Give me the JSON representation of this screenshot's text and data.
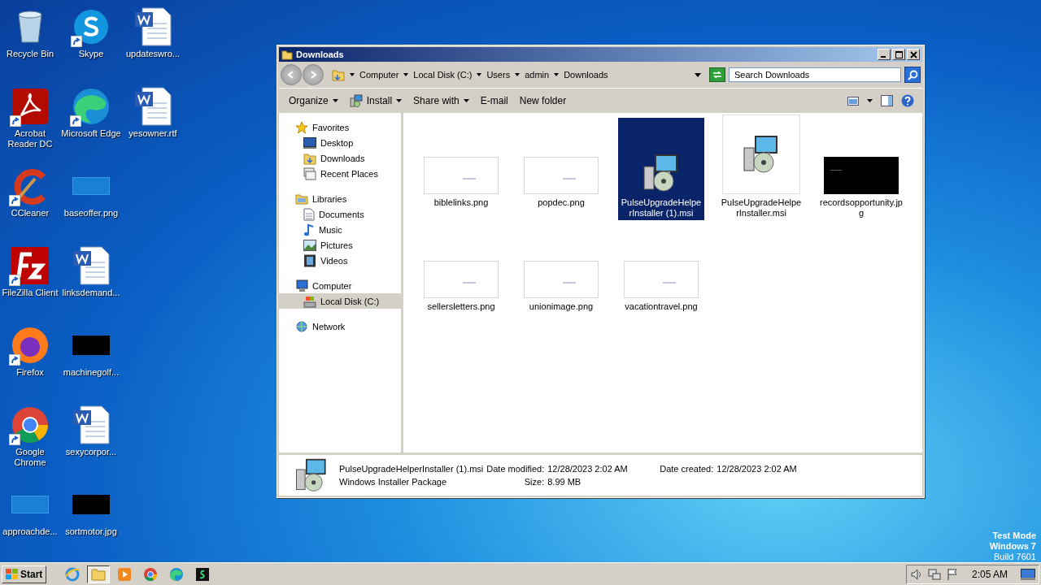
{
  "desktop": {
    "icons": [
      {
        "label": "Recycle Bin",
        "kind": "recycle",
        "shortcut": false
      },
      {
        "label": "Acrobat Reader DC",
        "kind": "pdf",
        "shortcut": true
      },
      {
        "label": "CCleaner",
        "kind": "ccleaner",
        "shortcut": true
      },
      {
        "label": "FileZilla Client",
        "kind": "filezilla",
        "shortcut": true
      },
      {
        "label": "Firefox",
        "kind": "firefox",
        "shortcut": true
      },
      {
        "label": "Google Chrome",
        "kind": "chrome",
        "shortcut": true
      },
      {
        "label": "approachde...",
        "kind": "blank",
        "shortcut": false
      },
      {
        "label": "Skype",
        "kind": "skype",
        "shortcut": true
      },
      {
        "label": "Microsoft Edge",
        "kind": "edge",
        "shortcut": true
      },
      {
        "label": "baseoffer.png",
        "kind": "blank",
        "shortcut": false
      },
      {
        "label": "linksdemand...",
        "kind": "word",
        "shortcut": false
      },
      {
        "label": "machinegolf...",
        "kind": "dark",
        "shortcut": false
      },
      {
        "label": "sexycorpor...",
        "kind": "word",
        "shortcut": false
      },
      {
        "label": "sortmotor.jpg",
        "kind": "dark",
        "shortcut": false
      },
      {
        "label": "updateswro...",
        "kind": "word",
        "shortcut": false
      },
      {
        "label": "yesowner.rtf",
        "kind": "word",
        "shortcut": false
      }
    ]
  },
  "window": {
    "title": "Downloads",
    "address": [
      "Computer",
      "Local Disk (C:)",
      "Users",
      "admin",
      "Downloads"
    ],
    "search": {
      "placeholder": "Search Downloads"
    },
    "toolbar": [
      {
        "label": "Organize",
        "kind": "menu"
      },
      {
        "label": "Install",
        "kind": "install"
      },
      {
        "label": "Share with",
        "kind": "menu"
      },
      {
        "label": "E-mail",
        "kind": "plain"
      },
      {
        "label": "New folder",
        "kind": "plain"
      }
    ],
    "sidebar": {
      "groups": [
        {
          "label": "Favorites",
          "kind": "star",
          "selected": false,
          "children": [
            {
              "label": "Desktop",
              "kind": "desktop",
              "selected": false
            },
            {
              "label": "Downloads",
              "kind": "folder",
              "selected": false
            },
            {
              "label": "Recent Places",
              "kind": "recent",
              "selected": false
            }
          ]
        },
        {
          "label": "Libraries",
          "kind": "library",
          "selected": false,
          "children": [
            {
              "label": "Documents",
              "kind": "document",
              "selected": false
            },
            {
              "label": "Music",
              "kind": "music",
              "selected": false
            },
            {
              "label": "Pictures",
              "kind": "pictures",
              "selected": false
            },
            {
              "label": "Videos",
              "kind": "videos",
              "selected": false
            }
          ]
        },
        {
          "label": "Computer",
          "kind": "computer",
          "selected": false,
          "children": [
            {
              "label": "Local Disk (C:)",
              "kind": "disk",
              "selected": true
            }
          ]
        },
        {
          "label": "Network",
          "kind": "network",
          "selected": false
        }
      ]
    },
    "files": [
      {
        "name": "biblelinks.png",
        "kind": "light",
        "selected": false
      },
      {
        "name": "popdec.png",
        "kind": "light",
        "selected": false
      },
      {
        "name": "PulseUpgradeHelperInstaller (1).msi",
        "kind": "msi",
        "selected": true
      },
      {
        "name": "PulseUpgradeHelperInstaller.msi",
        "kind": "msi",
        "selected": false
      },
      {
        "name": "recordsopportunity.jpg",
        "kind": "dark",
        "selected": false
      },
      {
        "name": "sellersletters.png",
        "kind": "light",
        "selected": false
      },
      {
        "name": "unionimage.png",
        "kind": "light",
        "selected": false
      },
      {
        "name": "vacationtravel.png",
        "kind": "light",
        "selected": false
      }
    ],
    "details": {
      "name": "PulseUpgradeHelperInstaller (1).msi",
      "type": "Windows Installer Package",
      "modified": {
        "label": "Date modified:",
        "value": "12/28/2023 2:02 AM"
      },
      "created": {
        "label": "Date created:",
        "value": "12/28/2023 2:02 AM"
      },
      "size": {
        "label": "Size:",
        "value": "8.99 MB"
      }
    }
  },
  "taskbar": {
    "start": "Start",
    "apps": [
      {
        "kind": "ie",
        "active": false
      },
      {
        "kind": "explorer",
        "active": true
      },
      {
        "kind": "media",
        "active": false
      },
      {
        "kind": "chrome",
        "active": false
      },
      {
        "kind": "edge",
        "active": false
      },
      {
        "kind": "terminal",
        "active": false
      }
    ],
    "clock": "2:05 AM"
  },
  "watermark": [
    "Test Mode",
    "Windows 7",
    "Build 7601"
  ]
}
